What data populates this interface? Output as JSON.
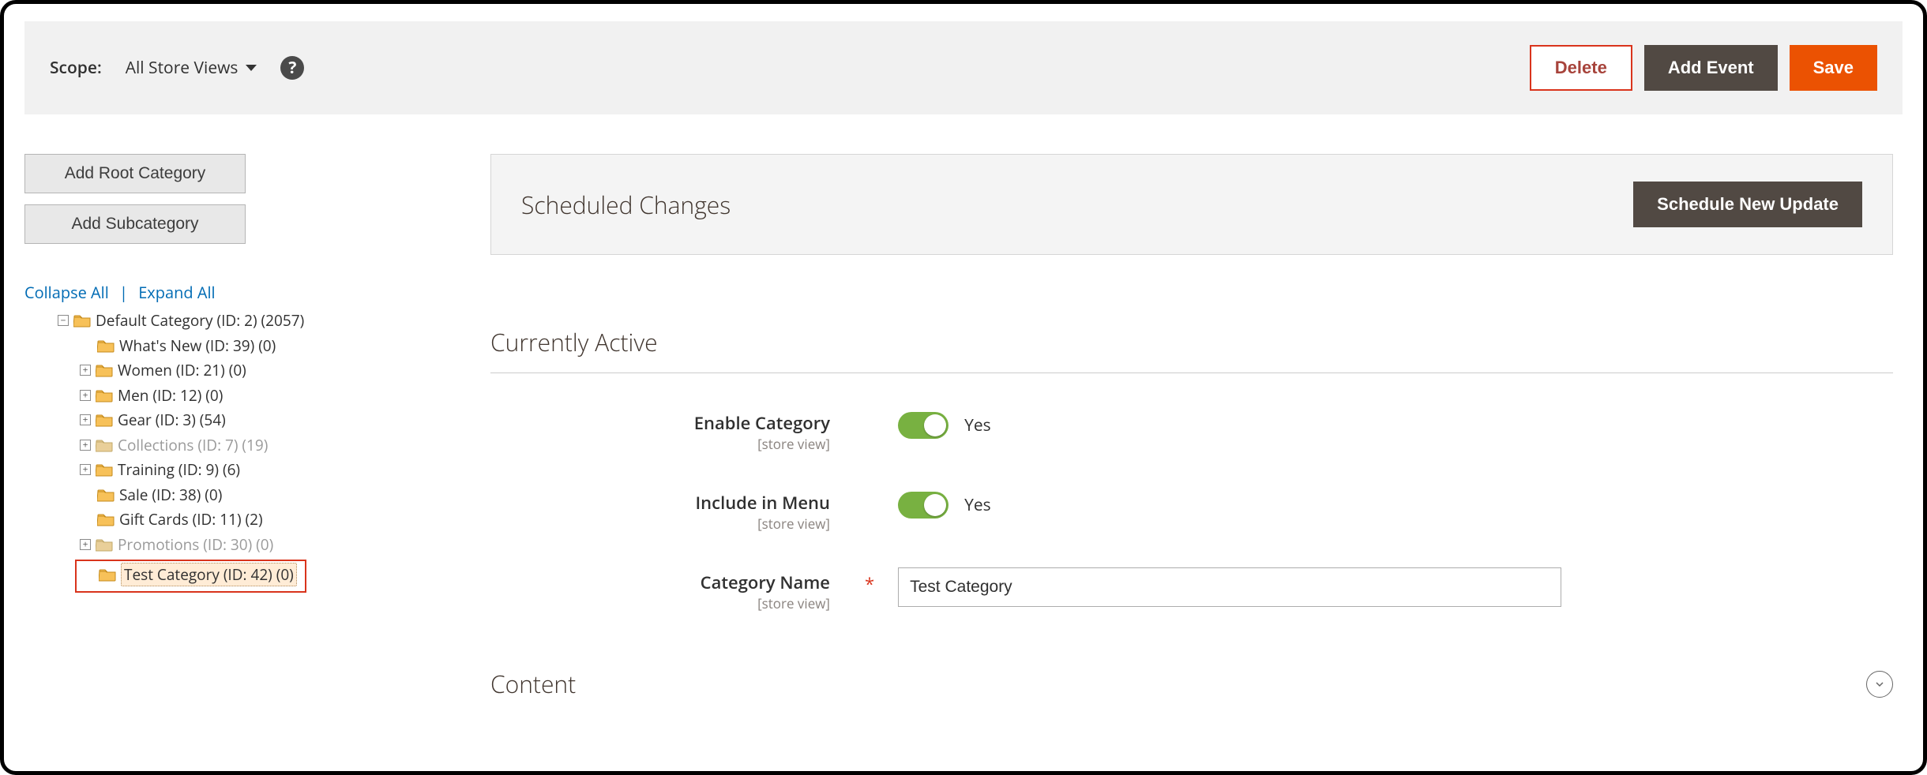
{
  "topbar": {
    "scope_label": "Scope:",
    "scope_value": "All Store Views",
    "delete_label": "Delete",
    "add_event_label": "Add Event",
    "save_label": "Save"
  },
  "sidebar": {
    "add_root_label": "Add Root Category",
    "add_sub_label": "Add Subcategory",
    "collapse_label": "Collapse All",
    "expand_label": "Expand All"
  },
  "tree": {
    "root": "Default Category (ID: 2) (2057)",
    "children": [
      {
        "label": "What's New (ID: 39) (0)",
        "expandable": false,
        "disabled": false
      },
      {
        "label": "Women (ID: 21) (0)",
        "expandable": true,
        "disabled": false
      },
      {
        "label": "Men (ID: 12) (0)",
        "expandable": true,
        "disabled": false
      },
      {
        "label": "Gear (ID: 3) (54)",
        "expandable": true,
        "disabled": false
      },
      {
        "label": "Collections (ID: 7) (19)",
        "expandable": true,
        "disabled": true
      },
      {
        "label": "Training (ID: 9) (6)",
        "expandable": true,
        "disabled": false
      },
      {
        "label": "Sale (ID: 38) (0)",
        "expandable": false,
        "disabled": false
      },
      {
        "label": "Gift Cards (ID: 11) (2)",
        "expandable": false,
        "disabled": false
      },
      {
        "label": "Promotions (ID: 30) (0)",
        "expandable": true,
        "disabled": true
      },
      {
        "label": "Test Category (ID: 42) (0)",
        "expandable": false,
        "disabled": false,
        "selected": true
      }
    ]
  },
  "scheduled": {
    "title": "Scheduled Changes",
    "button": "Schedule New Update"
  },
  "active": {
    "title": "Currently Active",
    "store_view_hint": "[store view]",
    "enable_label": "Enable Category",
    "enable_value": "Yes",
    "menu_label": "Include in Menu",
    "menu_value": "Yes",
    "name_label": "Category Name",
    "name_value": "Test Category"
  },
  "content": {
    "title": "Content"
  }
}
